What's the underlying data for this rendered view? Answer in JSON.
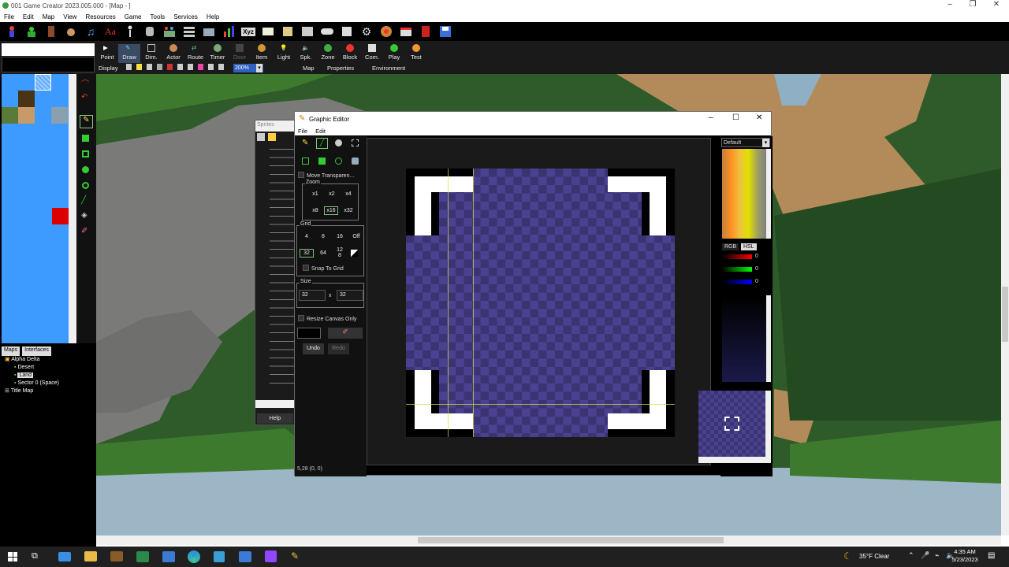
{
  "window": {
    "title": "001 Game Creator 2023.005.000 - [Map - ]"
  },
  "menu": [
    "File",
    "Edit",
    "Map",
    "View",
    "Resources",
    "Game",
    "Tools",
    "Services",
    "Help"
  ],
  "toolbar2": {
    "buttons": [
      "Point",
      "Draw",
      "Dim.",
      "Actor",
      "Route",
      "Timer",
      "Door",
      "Item",
      "Light",
      "Spk.",
      "Zone",
      "Block",
      "Com.",
      "Play",
      "Test"
    ],
    "display_label": "Display",
    "zoom": "200%",
    "tabs": [
      "Map",
      "Properties",
      "Environment"
    ]
  },
  "tree": {
    "tabs": [
      "Maps",
      "Interfaces"
    ],
    "items": [
      "Alpha Delta",
      "Desert",
      "Land",
      "Sector 0 (Space)",
      "Title Map"
    ]
  },
  "sprites": {
    "title": "Sprites",
    "help": "Help"
  },
  "graphic_editor": {
    "title": "Graphic Editor",
    "menu": [
      "File",
      "Edit"
    ],
    "move_transparent": "Move Transparen...",
    "zoom_label": "Zoom",
    "zoom_options": [
      "x1",
      "x2",
      "x4",
      "x8",
      "x16",
      "x32"
    ],
    "zoom_selected": "x16",
    "grid_label": "Grid",
    "grid_options": [
      "4",
      "8",
      "16",
      "Off",
      "32",
      "64",
      "12\n8"
    ],
    "grid_selected": "32",
    "snap": "Snap To Grid",
    "size_label": "Size",
    "size_w": "32",
    "size_x": "x",
    "size_h": "32",
    "resize_only": "Resize Canvas Only",
    "undo": "Undo",
    "redo": "Redo",
    "status": "5,28 (0, 0)",
    "palette_select": "Default",
    "color_tabs": [
      "RGB",
      "HSL"
    ],
    "rgb_values": [
      "0",
      "0",
      "0"
    ]
  },
  "taskbar": {
    "weather": "35°F  Clear",
    "time": "4:35 AM",
    "date": "5/23/2023"
  },
  "colors": {
    "water": "#3d9bff",
    "canvas_dark": "#3b3473",
    "canvas_light": "#4a4290",
    "grass": "#2f5a2a",
    "rock": "#7a7a78"
  }
}
